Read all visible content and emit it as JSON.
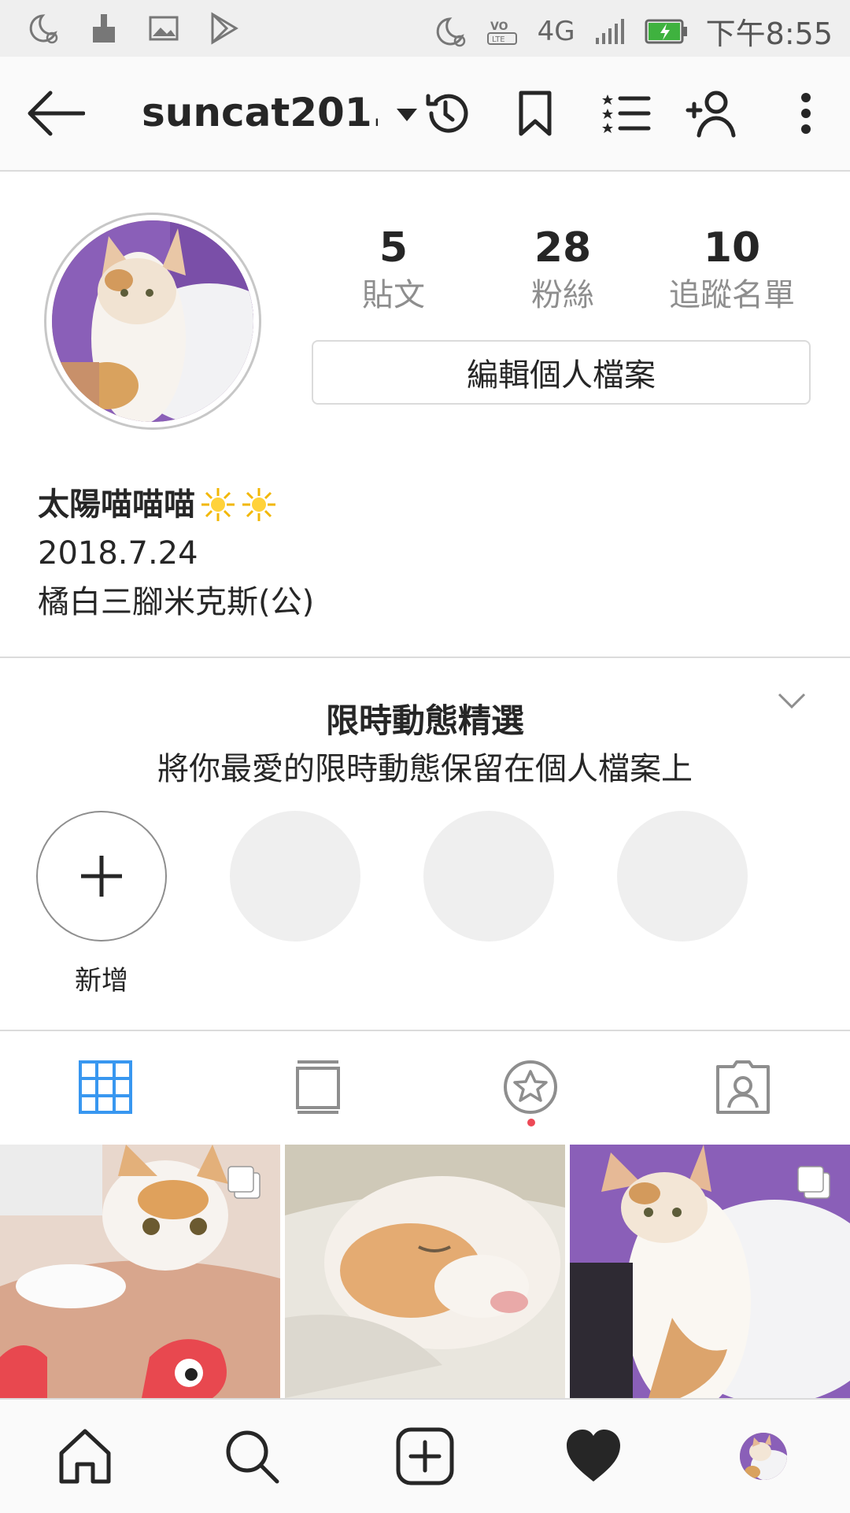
{
  "status_bar": {
    "network": "4G",
    "time": "下午8:55",
    "left_icons": [
      "moon-alarm-icon",
      "cleaner-icon",
      "image-icon",
      "play-store-icon"
    ],
    "right_icons": [
      "moon-alarm-icon",
      "volte-icon",
      "signal-icon",
      "battery-charging-icon"
    ]
  },
  "header": {
    "username": "suncat201..",
    "actions": [
      "history-icon",
      "bookmark-icon",
      "close-friends-list-icon",
      "add-person-icon",
      "more-icon"
    ]
  },
  "profile": {
    "stats": [
      {
        "value": "5",
        "label": "貼文"
      },
      {
        "value": "28",
        "label": "粉絲"
      },
      {
        "value": "10",
        "label": "追蹤名單"
      }
    ],
    "edit_button": "編輯個人檔案",
    "bio": {
      "name": "太陽喵喵喵",
      "line1": "2018.7.24",
      "line2": "橘白三腳米克斯(公)"
    }
  },
  "highlights": {
    "title": "限時動態精選",
    "subtitle": "將你最愛的限時動態保留在個人檔案上",
    "add_label": "新增"
  },
  "tabs": [
    "grid-icon",
    "feed-icon",
    "saved-tags-icon",
    "tagged-icon"
  ],
  "bottom_nav": [
    "home-icon",
    "search-icon",
    "new-post-icon",
    "activity-heart-icon",
    "profile-avatar"
  ],
  "colors": {
    "accent_blue": "#3897f0",
    "text": "#262626",
    "secondary_text": "#8e8e8e",
    "divider": "#dbdbdb",
    "notification_red": "#ed4956"
  }
}
